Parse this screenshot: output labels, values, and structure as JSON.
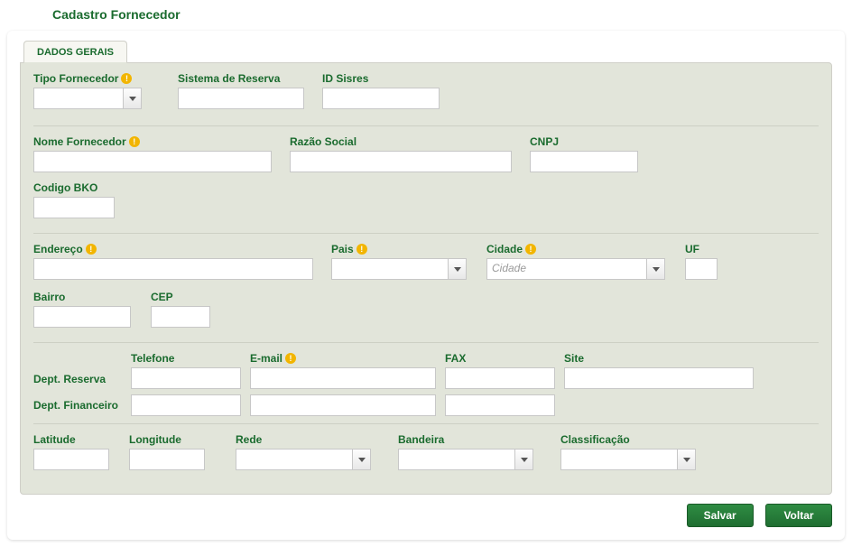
{
  "page": {
    "title": "Cadastro Fornecedor"
  },
  "tabs": {
    "dados_gerais": "DADOS GERAIS"
  },
  "labels": {
    "tipo_fornecedor": "Tipo Fornecedor",
    "sistema_reserva": "Sistema de Reserva",
    "id_sisres": "ID Sisres",
    "nome_fornecedor": "Nome Fornecedor",
    "razao_social": "Razão Social",
    "cnpj": "CNPJ",
    "codigo_bko": "Codigo BKO",
    "endereco": "Endereço",
    "pais": "Pais",
    "cidade": "Cidade",
    "uf": "UF",
    "bairro": "Bairro",
    "cep": "CEP",
    "dept_reserva": "Dept. Reserva",
    "dept_financeiro": "Dept. Financeiro",
    "telefone": "Telefone",
    "email": "E-mail",
    "fax": "FAX",
    "site": "Site",
    "latitude": "Latitude",
    "longitude": "Longitude",
    "rede": "Rede",
    "bandeira": "Bandeira",
    "classificacao": "Classificação"
  },
  "values": {
    "tipo_fornecedor": "",
    "sistema_reserva": "",
    "id_sisres": "",
    "nome_fornecedor": "",
    "razao_social": "",
    "cnpj": "",
    "codigo_bko": "",
    "endereco": "",
    "pais": "",
    "cidade": "",
    "uf": "",
    "bairro": "",
    "cep": "",
    "reserva_telefone": "",
    "reserva_email": "",
    "reserva_fax": "",
    "reserva_site": "",
    "fin_telefone": "",
    "fin_email": "",
    "fin_fax": "",
    "latitude": "",
    "longitude": "",
    "rede": "",
    "bandeira": "",
    "classificacao": ""
  },
  "placeholders": {
    "cidade": "Cidade"
  },
  "buttons": {
    "salvar": "Salvar",
    "voltar": "Voltar"
  }
}
